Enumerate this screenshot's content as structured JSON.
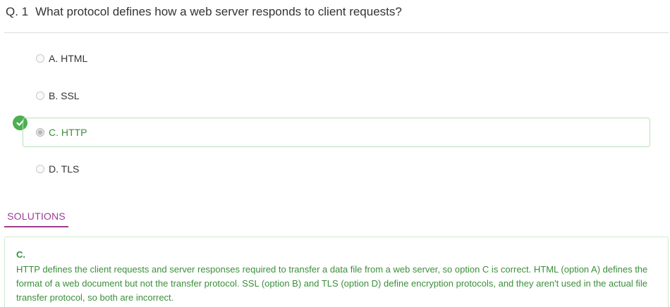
{
  "question": {
    "number": "Q. 1",
    "text": "What protocol defines how a web server responds to client requests?"
  },
  "options": [
    {
      "label": "A. HTML",
      "selected": false,
      "correct": false
    },
    {
      "label": "B. SSL",
      "selected": false,
      "correct": false
    },
    {
      "label": "C. HTTP",
      "selected": true,
      "correct": true
    },
    {
      "label": "D. TLS",
      "selected": false,
      "correct": false
    }
  ],
  "solutions": {
    "tab_label": "SOLUTIONS",
    "answer": "C.",
    "explanation": "HTTP defines the client requests and server responses required to transfer a data file from a web server, so option C is correct. HTML (option A) defines the format of a web document but not the transfer protocol. SSL (option B) and TLS (option D) define encryption protocols, and they aren't used in the actual file transfer protocol, so both are incorrect."
  },
  "colors": {
    "correct_green": "#4caf50",
    "solution_text": "#3a8f3a",
    "tab_accent": "#9c3b93"
  },
  "icons": {
    "correct_indicator": "check-circle-icon"
  }
}
